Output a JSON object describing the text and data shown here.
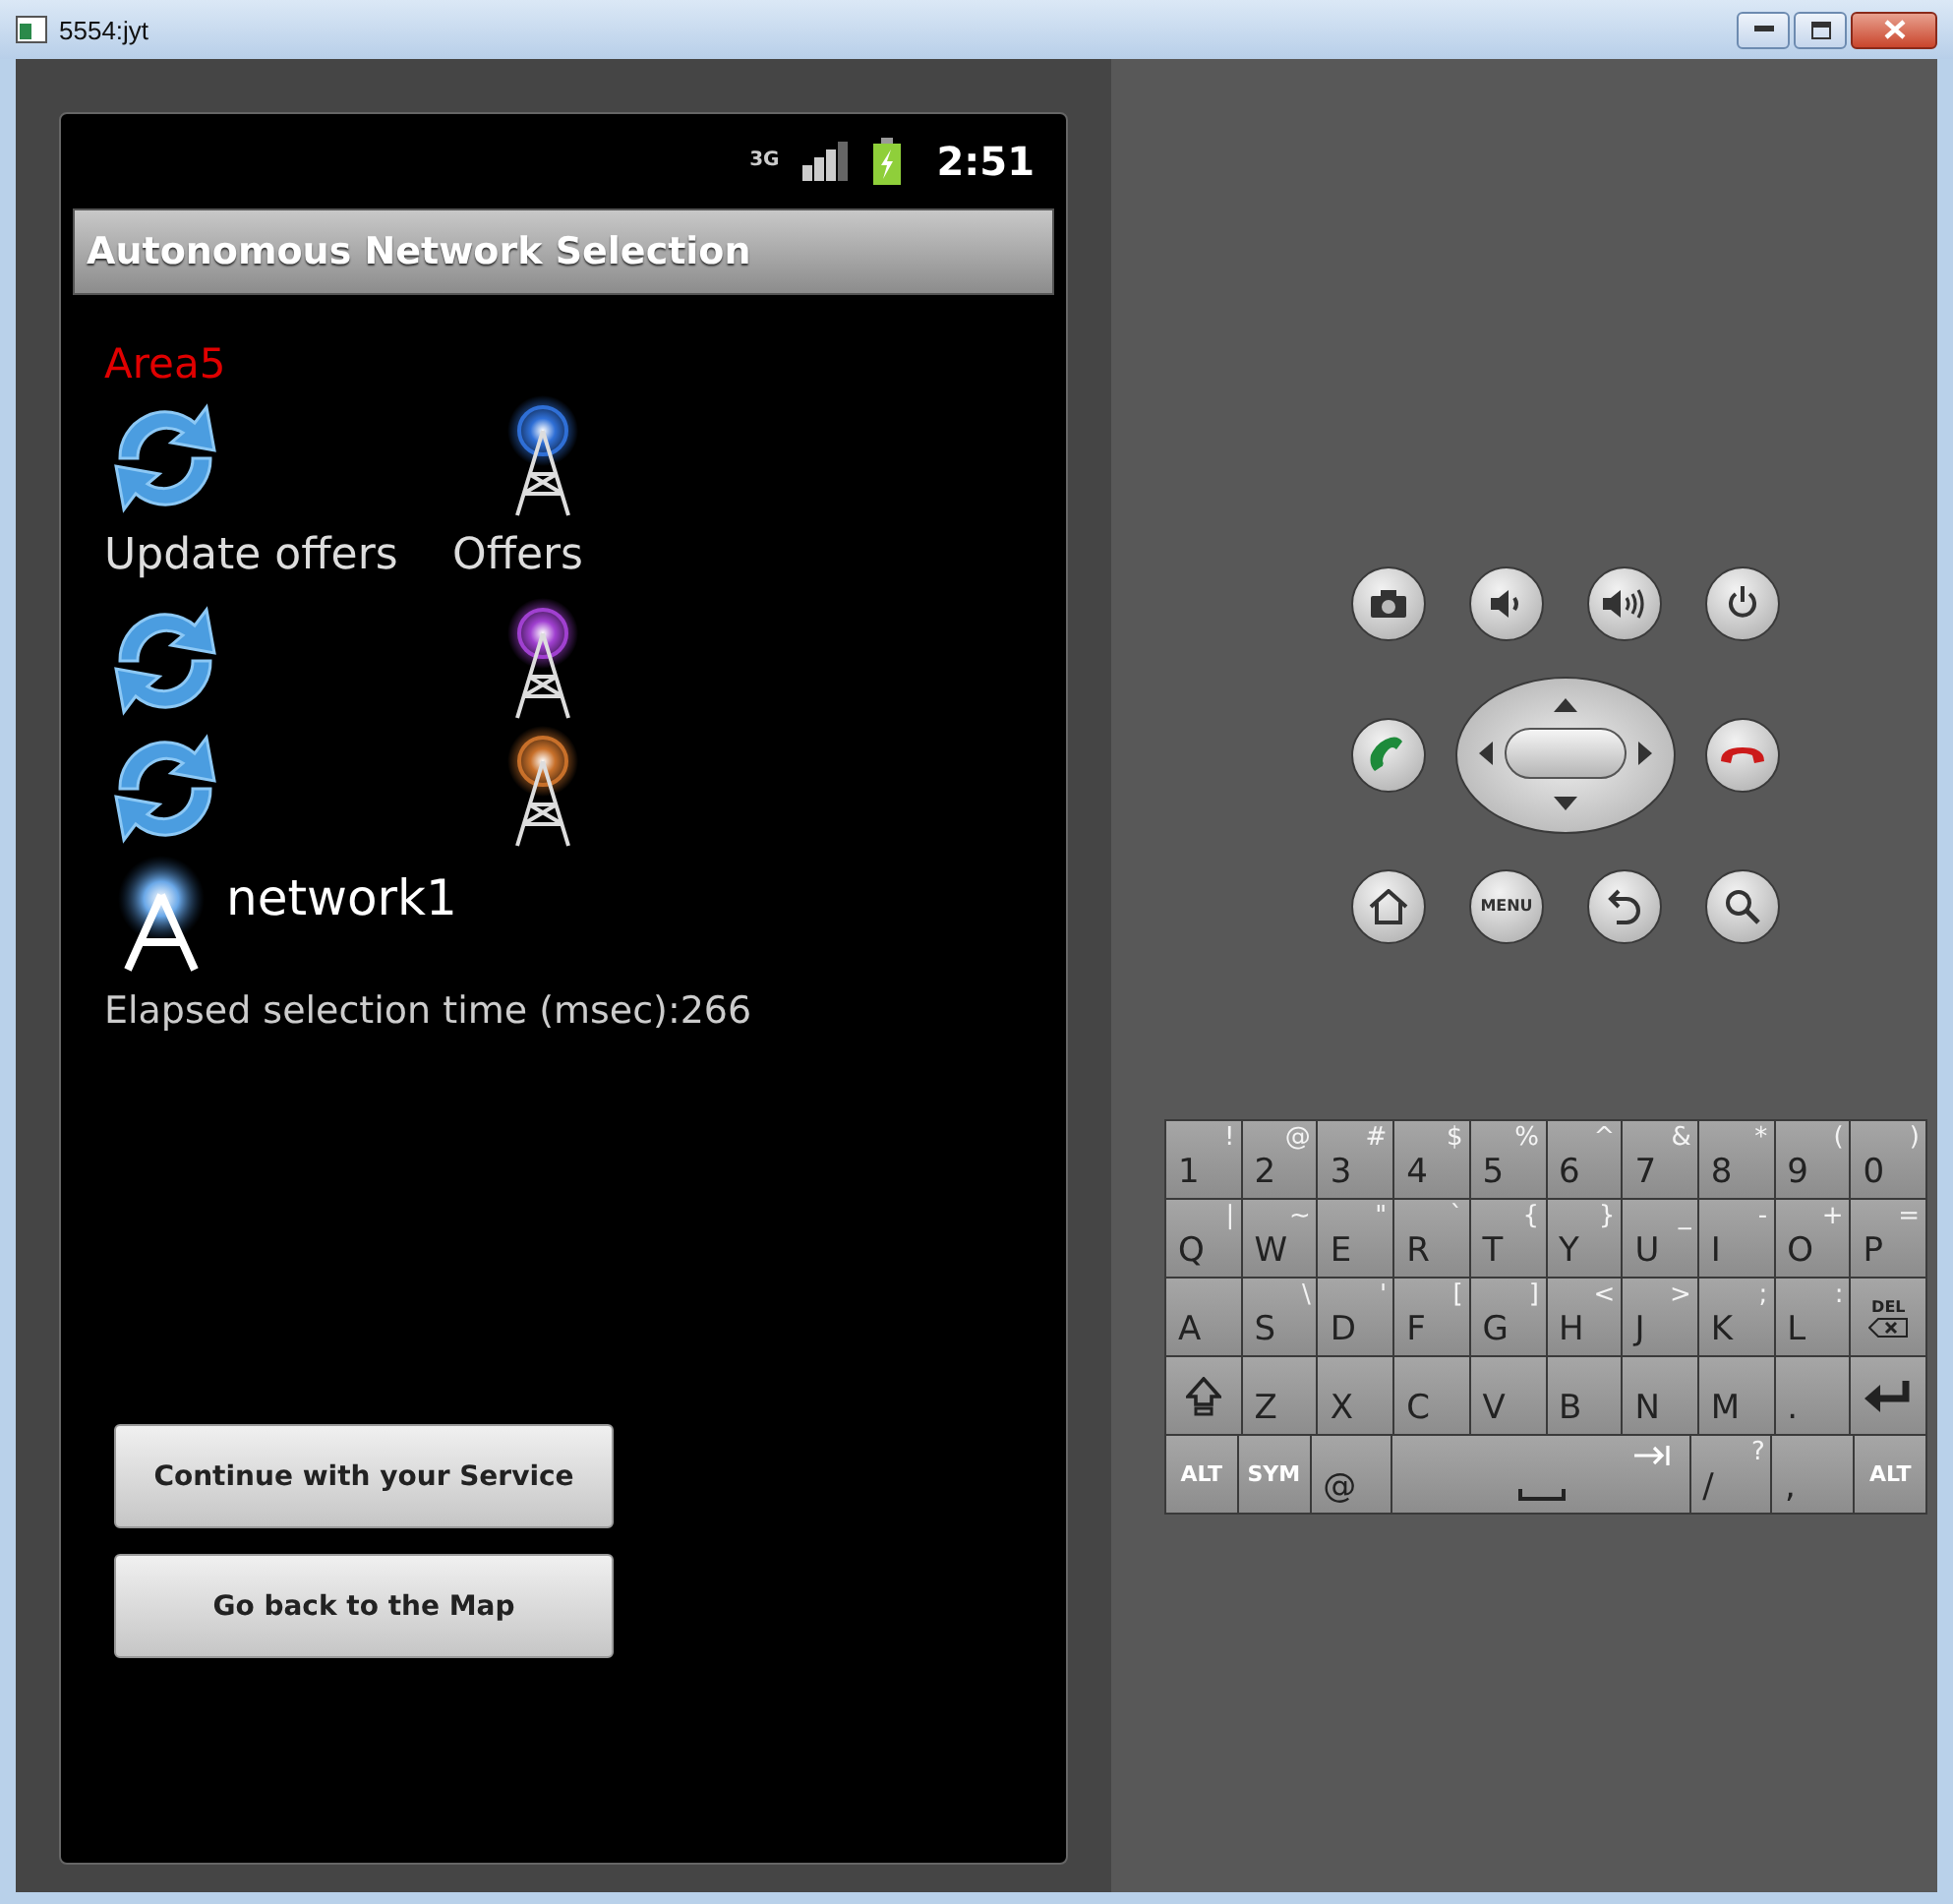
{
  "window": {
    "title": "5554:jyt"
  },
  "status_bar": {
    "network_type": "3G",
    "time": "2:51"
  },
  "app_title": "Autonomous Network Selection",
  "area": "Area5",
  "offers": {
    "rows": [
      {
        "color": "#2f6fd6"
      },
      {
        "color": "#a040d0"
      },
      {
        "color": "#c8702a"
      }
    ],
    "update_label": "Update offers",
    "offers_label": "Offers"
  },
  "selected_network": "network1",
  "elapsed": "Elapsed selection time (msec):266",
  "buttons": [
    "Continue with your Service",
    "Go back to the Map"
  ],
  "hardware_keys": {
    "menu_label": "MENU"
  },
  "keyboard": {
    "rows": [
      [
        {
          "kind": "char",
          "label": "1",
          "alt": "!"
        },
        {
          "kind": "char",
          "label": "2",
          "alt": "@"
        },
        {
          "kind": "char",
          "label": "3",
          "alt": "#"
        },
        {
          "kind": "char",
          "label": "4",
          "alt": "$"
        },
        {
          "kind": "char",
          "label": "5",
          "alt": "%"
        },
        {
          "kind": "char",
          "label": "6",
          "alt": "^"
        },
        {
          "kind": "char",
          "label": "7",
          "alt": "&"
        },
        {
          "kind": "char",
          "label": "8",
          "alt": "*"
        },
        {
          "kind": "char",
          "label": "9",
          "alt": "("
        },
        {
          "kind": "char",
          "label": "0",
          "alt": ")"
        }
      ],
      [
        {
          "kind": "char",
          "label": "Q",
          "alt": "|"
        },
        {
          "kind": "char",
          "label": "W",
          "alt": "~"
        },
        {
          "kind": "char",
          "label": "E",
          "alt": "\""
        },
        {
          "kind": "char",
          "label": "R",
          "alt": "`"
        },
        {
          "kind": "char",
          "label": "T",
          "alt": "{"
        },
        {
          "kind": "char",
          "label": "Y",
          "alt": "}"
        },
        {
          "kind": "char",
          "label": "U",
          "alt": "_"
        },
        {
          "kind": "char",
          "label": "I",
          "alt": "-"
        },
        {
          "kind": "char",
          "label": "O",
          "alt": "+"
        },
        {
          "kind": "char",
          "label": "P",
          "alt": "="
        }
      ],
      [
        {
          "kind": "char",
          "label": "A"
        },
        {
          "kind": "char",
          "label": "S",
          "alt": "\\"
        },
        {
          "kind": "char",
          "label": "D",
          "alt": "'"
        },
        {
          "kind": "char",
          "label": "F",
          "alt": "["
        },
        {
          "kind": "char",
          "label": "G",
          "alt": "]"
        },
        {
          "kind": "char",
          "label": "H",
          "alt": "<"
        },
        {
          "kind": "char",
          "label": "J",
          "alt": ">"
        },
        {
          "kind": "char",
          "label": "K",
          "alt": ";"
        },
        {
          "kind": "char",
          "label": "L",
          "alt": ":"
        },
        {
          "kind": "delete",
          "label": "DEL"
        }
      ],
      [
        {
          "kind": "shift"
        },
        {
          "kind": "char",
          "label": "Z"
        },
        {
          "kind": "char",
          "label": "X"
        },
        {
          "kind": "char",
          "label": "C"
        },
        {
          "kind": "char",
          "label": "V"
        },
        {
          "kind": "char",
          "label": "B"
        },
        {
          "kind": "char",
          "label": "N"
        },
        {
          "kind": "char",
          "label": "M"
        },
        {
          "kind": "char",
          "label": "."
        },
        {
          "kind": "enter"
        }
      ]
    ],
    "bottom_row": [
      {
        "kind": "mod",
        "label": "ALT"
      },
      {
        "kind": "mod",
        "label": "SYM"
      },
      {
        "kind": "char",
        "label": "@"
      },
      {
        "kind": "space"
      },
      {
        "kind": "char",
        "label": "/",
        "alt": "?"
      },
      {
        "kind": "char",
        "label": ","
      },
      {
        "kind": "mod",
        "label": "ALT"
      }
    ]
  }
}
